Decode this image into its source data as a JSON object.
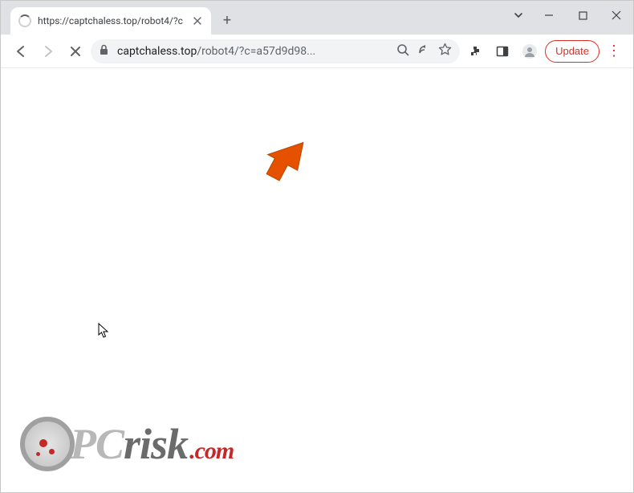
{
  "tab": {
    "title": "https://captchaless.top/robot4/?c"
  },
  "url": {
    "domain": "captchaless.top",
    "path": "/robot4/?c=a57d9d98..."
  },
  "toolbar": {
    "update_label": "Update"
  },
  "watermark": {
    "pc": "PC",
    "risk": "risk",
    "com": ".com"
  }
}
